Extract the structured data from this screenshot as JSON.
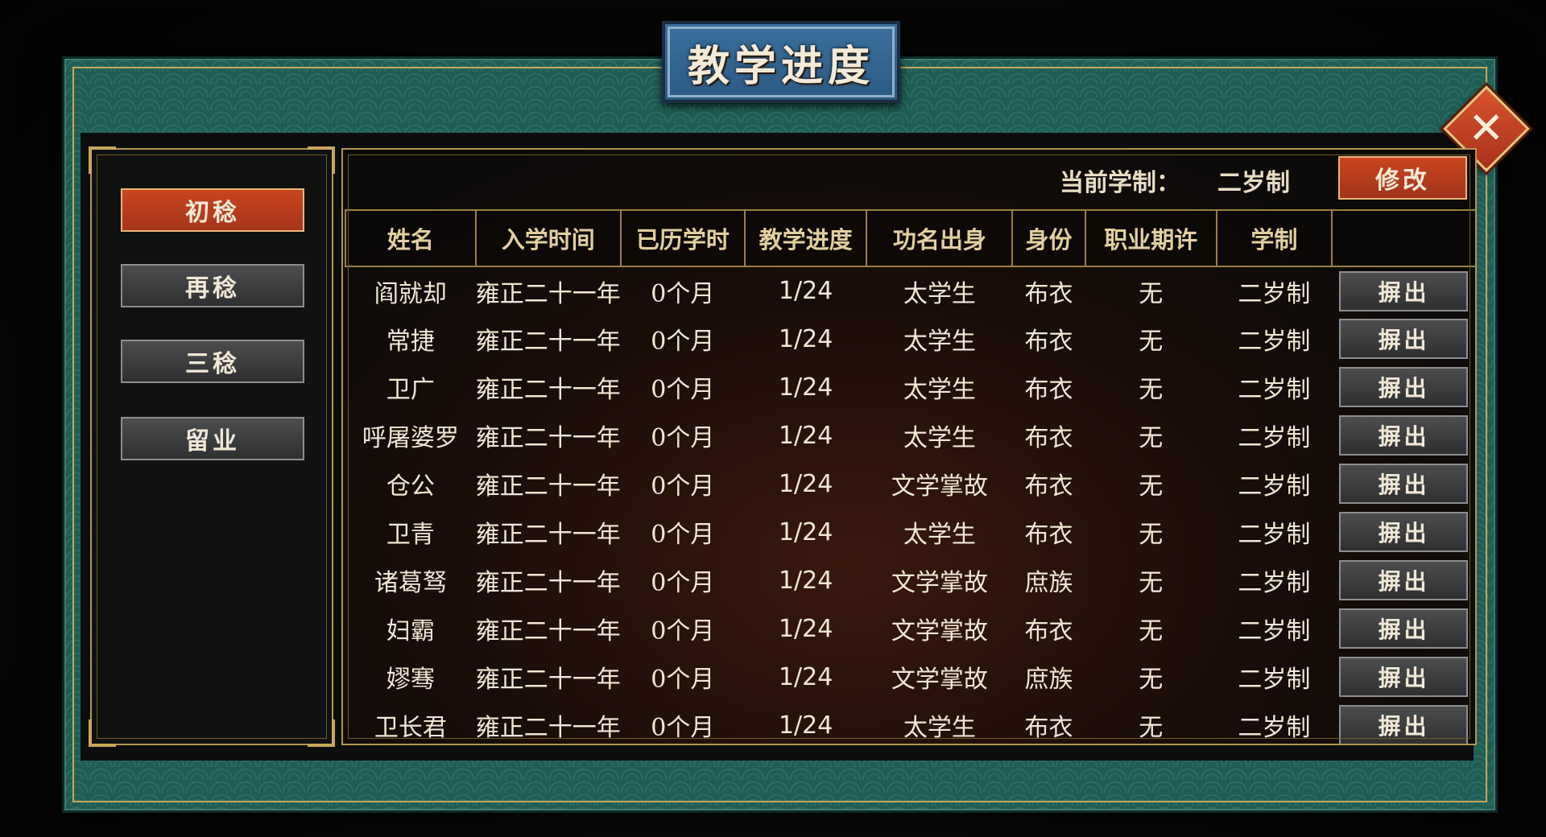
{
  "title": "教学进度",
  "close_glyph": "✕",
  "sidebar": {
    "items": [
      {
        "label": "初稔",
        "active": true
      },
      {
        "label": "再稔",
        "active": false
      },
      {
        "label": "三稔",
        "active": false
      },
      {
        "label": "留业",
        "active": false
      }
    ]
  },
  "term": {
    "label": "当前学制：",
    "value": "二岁制",
    "modify_label": "修改"
  },
  "table": {
    "columns": [
      "姓名",
      "入学时间",
      "已历学时",
      "教学进度",
      "功名出身",
      "身份",
      "职业期许",
      "学制",
      ""
    ],
    "action_label": "摒出",
    "rows": [
      {
        "name": "阎就却",
        "enroll": "雍正二十一年",
        "elapsed": "0个月",
        "progress": "1/24",
        "rank": "太学生",
        "status": "布衣",
        "career": "无",
        "term": "二岁制"
      },
      {
        "name": "常捷",
        "enroll": "雍正二十一年",
        "elapsed": "0个月",
        "progress": "1/24",
        "rank": "太学生",
        "status": "布衣",
        "career": "无",
        "term": "二岁制"
      },
      {
        "name": "卫广",
        "enroll": "雍正二十一年",
        "elapsed": "0个月",
        "progress": "1/24",
        "rank": "太学生",
        "status": "布衣",
        "career": "无",
        "term": "二岁制"
      },
      {
        "name": "呼屠婆罗",
        "enroll": "雍正二十一年",
        "elapsed": "0个月",
        "progress": "1/24",
        "rank": "太学生",
        "status": "布衣",
        "career": "无",
        "term": "二岁制"
      },
      {
        "name": "仓公",
        "enroll": "雍正二十一年",
        "elapsed": "0个月",
        "progress": "1/24",
        "rank": "文学掌故",
        "status": "布衣",
        "career": "无",
        "term": "二岁制"
      },
      {
        "name": "卫青",
        "enroll": "雍正二十一年",
        "elapsed": "0个月",
        "progress": "1/24",
        "rank": "太学生",
        "status": "布衣",
        "career": "无",
        "term": "二岁制"
      },
      {
        "name": "诸葛驽",
        "enroll": "雍正二十一年",
        "elapsed": "0个月",
        "progress": "1/24",
        "rank": "文学掌故",
        "status": "庶族",
        "career": "无",
        "term": "二岁制"
      },
      {
        "name": "妇霸",
        "enroll": "雍正二十一年",
        "elapsed": "0个月",
        "progress": "1/24",
        "rank": "文学掌故",
        "status": "布衣",
        "career": "无",
        "term": "二岁制"
      },
      {
        "name": "嫪骞",
        "enroll": "雍正二十一年",
        "elapsed": "0个月",
        "progress": "1/24",
        "rank": "文学掌故",
        "status": "庶族",
        "career": "无",
        "term": "二岁制"
      },
      {
        "name": "卫长君",
        "enroll": "雍正二十一年",
        "elapsed": "0个月",
        "progress": "1/24",
        "rank": "太学生",
        "status": "布衣",
        "career": "无",
        "term": "二岁制"
      }
    ]
  }
}
